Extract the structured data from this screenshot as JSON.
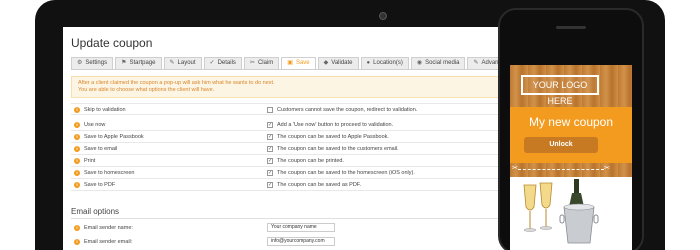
{
  "page": {
    "title": "Update coupon"
  },
  "tabs": [
    {
      "label": "Settings",
      "icon": "gear-icon",
      "glyph": "⚙"
    },
    {
      "label": "Startpage",
      "icon": "flag-icon",
      "glyph": "⚑"
    },
    {
      "label": "Layout",
      "icon": "edit-icon",
      "glyph": "✎"
    },
    {
      "label": "Details",
      "icon": "wrench-icon",
      "glyph": "✓"
    },
    {
      "label": "Claim",
      "icon": "scissors-icon",
      "glyph": "✂"
    },
    {
      "label": "Save",
      "icon": "save-icon",
      "glyph": "▣"
    },
    {
      "label": "Validate",
      "icon": "tag-icon",
      "glyph": "◆"
    },
    {
      "label": "Location(s)",
      "icon": "location-icon",
      "glyph": "●"
    },
    {
      "label": "Social media",
      "icon": "globe-icon",
      "glyph": "◉"
    },
    {
      "label": "Advanced",
      "icon": "wrench-icon",
      "glyph": "✎"
    }
  ],
  "active_tab": "Save",
  "info": {
    "line1": "After a client claimed the coupon a pop-up will ask him what he wants to do next.",
    "line2": "You are able to choose what options the client will have."
  },
  "options": [
    {
      "label": "Skip to validation",
      "checked": false,
      "mark": "",
      "description": "Customers cannot save the coupon, redirect to validation."
    },
    {
      "label": "Use now",
      "checked": true,
      "mark": "✓",
      "description": "Add a 'Use now' button to proceed to validation."
    },
    {
      "label": "Save to Apple Passbook",
      "checked": true,
      "mark": "✓",
      "description": "The coupon can be saved to Apple Passbook."
    },
    {
      "label": "Save to email",
      "checked": true,
      "mark": "✓",
      "description": "The coupon can be saved to the customers email."
    },
    {
      "label": "Print",
      "checked": true,
      "mark": "✓",
      "description": "The coupon can be printed."
    },
    {
      "label": "Save to homescreen",
      "checked": true,
      "mark": "✓",
      "description": "The coupon can be saved to the homescreen (iOS only)."
    },
    {
      "label": "Save to PDF",
      "checked": true,
      "mark": "✓",
      "description": "The coupon can be saved as PDF."
    }
  ],
  "email_section": {
    "title": "Email options",
    "fields": [
      {
        "label": "Email sender name:",
        "value": "Your company name"
      },
      {
        "label": "Email sender email:",
        "value": "info@yourcompany.com"
      }
    ]
  },
  "phone": {
    "logo": "YOUR LOGO HERE",
    "coupon_title": "My new coupon",
    "unlock": "Unlock"
  },
  "colors": {
    "accent": "#f29b1e",
    "info_bg": "#fdf5e4",
    "info_text": "#d9862b"
  }
}
